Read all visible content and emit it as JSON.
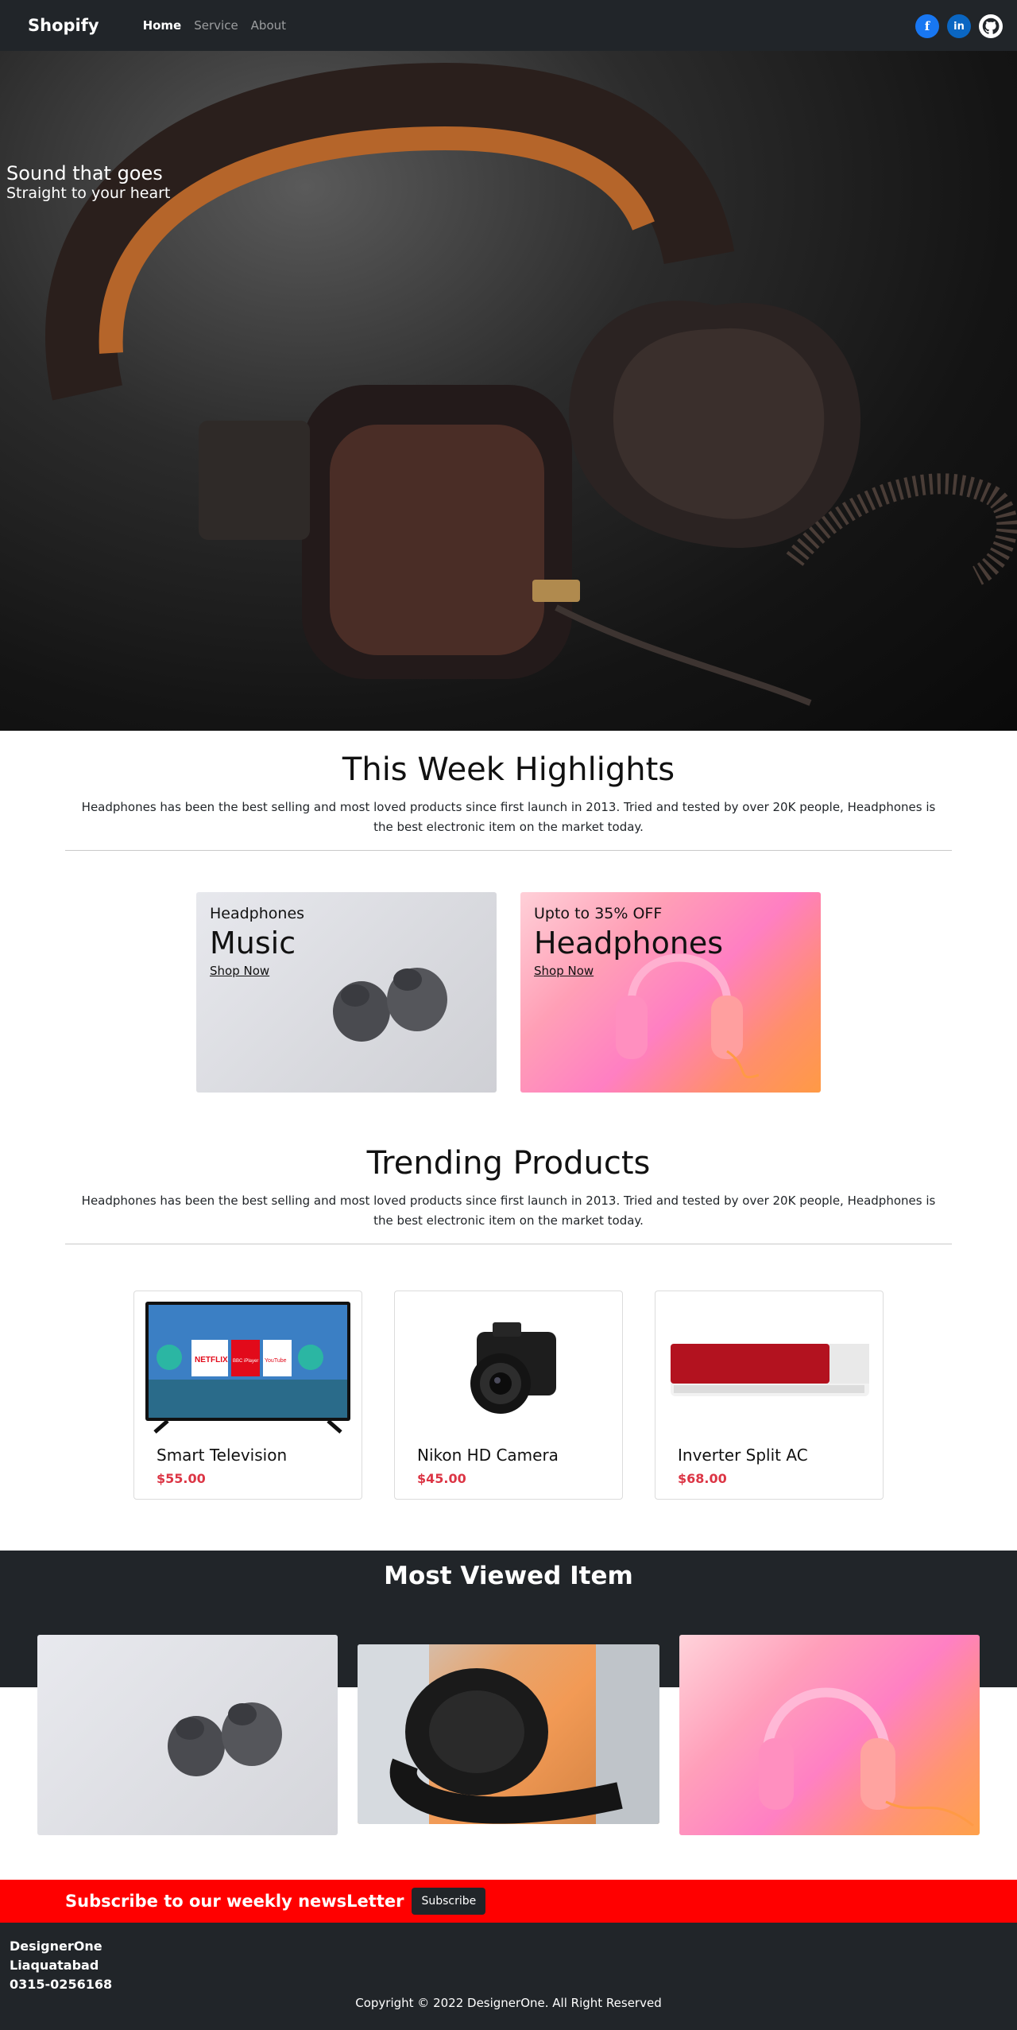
{
  "navbar": {
    "brand": "Shopify",
    "links": [
      "Home",
      "Service",
      "About"
    ],
    "social": {
      "facebook": "f",
      "linkedin": "in"
    }
  },
  "hero": {
    "line1": "Sound that goes",
    "line2": "Straight to your heart"
  },
  "highlights": {
    "title": "This Week Highlights",
    "description": "Headphones has been the best selling and most loved products since first launch in 2013. Tried and tested by over 20K people, Headphones is the best electronic item on the market today.",
    "cards": [
      {
        "small": "Headphones",
        "big": "Music",
        "link": "Shop Now"
      },
      {
        "small": "Upto to 35% OFF",
        "big": "Headphones",
        "link": "Shop Now"
      }
    ]
  },
  "trending": {
    "title": "Trending Products",
    "description": "Headphones has been the best selling and most loved products since first launch in 2013. Tried and tested by over 20K people, Headphones is the best electronic item on the market today.",
    "products": [
      {
        "name": "Smart Television",
        "price": "$55.00"
      },
      {
        "name": "Nikon HD Camera",
        "price": "$45.00"
      },
      {
        "name": "Inverter Split AC",
        "price": "$68.00"
      }
    ],
    "tv_apps": [
      "NETFLIX",
      "BBC iPlayer",
      "YouTube"
    ]
  },
  "most_viewed": {
    "title": "Most Viewed Item"
  },
  "newsletter": {
    "text": "Subscribe to our weekly newsLetter",
    "button": "Subscribe"
  },
  "footer": {
    "company": "DesignerOne",
    "city": "Liaquatabad",
    "phone": "0315-0256168",
    "copyright": "Copyright © 2022 DesignerOne. All Right Reserved"
  },
  "colors": {
    "dark": "#212529",
    "price": "#dc3545",
    "newsletter_bg": "#ff0000"
  }
}
